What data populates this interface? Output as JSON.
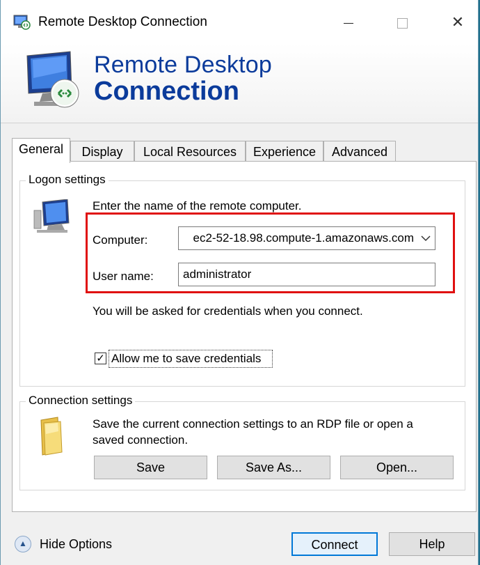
{
  "window": {
    "title": "Remote Desktop Connection",
    "controls": {
      "minimize": "minimize-icon",
      "maximize": "maximize-icon",
      "close": "✕"
    }
  },
  "banner": {
    "line1": "Remote Desktop",
    "line2": "Connection",
    "color": "#0b3b9b"
  },
  "tabs": [
    {
      "label": "General",
      "active": true
    },
    {
      "label": "Display"
    },
    {
      "label": "Local Resources"
    },
    {
      "label": "Experience"
    },
    {
      "label": "Advanced"
    }
  ],
  "logon": {
    "group_title": "Logon settings",
    "instruction": "Enter the name of the remote computer.",
    "computer_label": "Computer:",
    "computer_value": "ec2-52-18.98.compute-1.amazonaws.com",
    "username_label": "User name:",
    "username_value": "administrator",
    "credentials_note": "You will be asked for credentials when you connect.",
    "save_credentials_label": "Allow me to save credentials",
    "save_credentials_checked": true,
    "check_mark": "✓"
  },
  "connection": {
    "group_title": "Connection settings",
    "description_line1": "Save the current connection settings to an RDP file or open a",
    "description_line2": "saved connection.",
    "save_label": "Save",
    "save_as_label": "Save As...",
    "open_label": "Open..."
  },
  "footer": {
    "hide_options_label": "Hide Options",
    "hide_options_icon": "▲",
    "connect_label": "Connect",
    "help_label": "Help"
  },
  "colors": {
    "highlight": "#e01010",
    "accent": "#0078d7"
  }
}
